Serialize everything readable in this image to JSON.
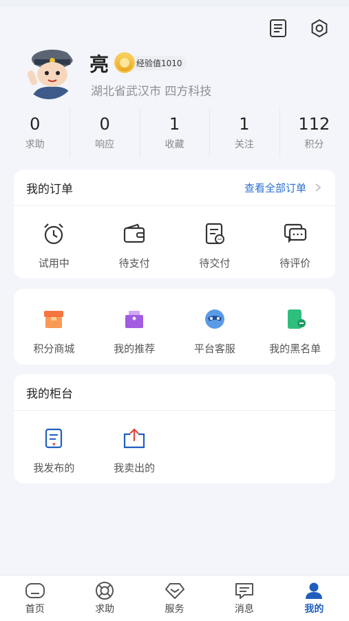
{
  "user": {
    "name": "亮",
    "exp_label": "经验值1010",
    "location": "湖北省武汉市 四方科技"
  },
  "stats": [
    {
      "value": "0",
      "label": "求助"
    },
    {
      "value": "0",
      "label": "响应"
    },
    {
      "value": "1",
      "label": "收藏"
    },
    {
      "value": "1",
      "label": "关注"
    },
    {
      "value": "112",
      "label": "积分"
    }
  ],
  "orders": {
    "title": "我的订单",
    "view_all": "查看全部订单",
    "items": [
      {
        "label": "试用中",
        "icon": "alarm-clock-icon"
      },
      {
        "label": "待支付",
        "icon": "wallet-icon"
      },
      {
        "label": "待交付",
        "icon": "document-icon"
      },
      {
        "label": "待评价",
        "icon": "chat-icon"
      }
    ]
  },
  "services": {
    "items": [
      {
        "label": "积分商城",
        "icon": "shop-icon",
        "color": "#f5743f"
      },
      {
        "label": "我的推荐",
        "icon": "recommend-icon",
        "color": "#a25ce0"
      },
      {
        "label": "平台客服",
        "icon": "customer-service-icon",
        "color": "#5b9be6"
      },
      {
        "label": "我的黑名单",
        "icon": "blacklist-icon",
        "color": "#2fbf7d"
      }
    ]
  },
  "counter": {
    "title": "我的柜台",
    "items": [
      {
        "label": "我发布的",
        "icon": "published-icon"
      },
      {
        "label": "我卖出的",
        "icon": "sold-icon"
      }
    ]
  },
  "tabbar": {
    "tabs": [
      {
        "label": "首页",
        "icon": "home-icon"
      },
      {
        "label": "求助",
        "icon": "lifebuoy-icon"
      },
      {
        "label": "服务",
        "icon": "service-icon"
      },
      {
        "label": "消息",
        "icon": "message-icon"
      },
      {
        "label": "我的",
        "icon": "profile-icon"
      }
    ],
    "active_index": 4
  },
  "colors": {
    "accent": "#1f5ebd",
    "link": "#2b6fd1",
    "background": "#f3f5fa"
  }
}
